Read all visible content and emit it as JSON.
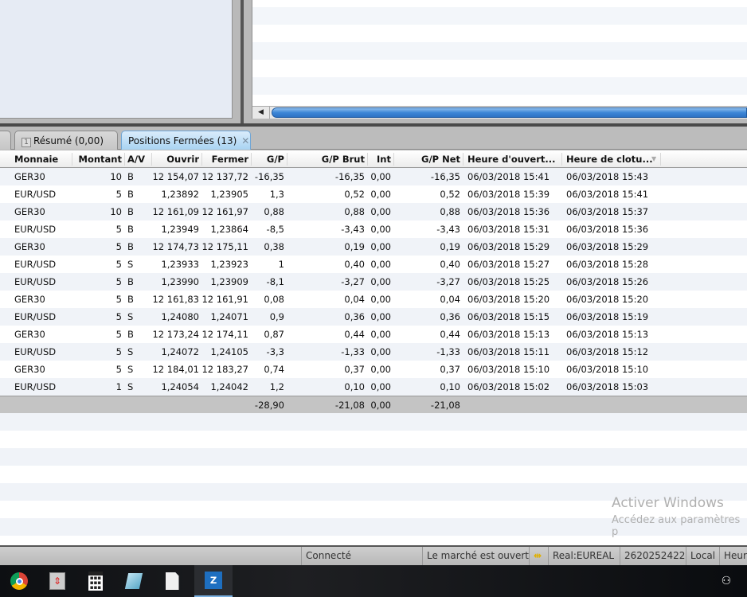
{
  "tabs": [
    {
      "num": "1",
      "label": "Résumé (0,00)"
    },
    {
      "label": "Positions Fermées (13)",
      "close": "✕"
    }
  ],
  "columns": [
    "Monnaie",
    "Montant",
    "A/V",
    "Ouvrir",
    "Fermer",
    "G/P",
    "G/P Brut",
    "Int",
    "G/P Net",
    "Heure d'ouvert...",
    "Heure de clotu..."
  ],
  "rows": [
    [
      "GER30",
      "10",
      "B",
      "12 154,07",
      "12 137,72",
      "-16,35",
      "-16,35",
      "0,00",
      "-16,35",
      "06/03/2018 15:41",
      "06/03/2018 15:43"
    ],
    [
      "EUR/USD",
      "5",
      "B",
      "1,23892",
      "1,23905",
      "1,3",
      "0,52",
      "0,00",
      "0,52",
      "06/03/2018 15:39",
      "06/03/2018 15:41"
    ],
    [
      "GER30",
      "10",
      "B",
      "12 161,09",
      "12 161,97",
      "0,88",
      "0,88",
      "0,00",
      "0,88",
      "06/03/2018 15:36",
      "06/03/2018 15:37"
    ],
    [
      "EUR/USD",
      "5",
      "B",
      "1,23949",
      "1,23864",
      "-8,5",
      "-3,43",
      "0,00",
      "-3,43",
      "06/03/2018 15:31",
      "06/03/2018 15:36"
    ],
    [
      "GER30",
      "5",
      "B",
      "12 174,73",
      "12 175,11",
      "0,38",
      "0,19",
      "0,00",
      "0,19",
      "06/03/2018 15:29",
      "06/03/2018 15:29"
    ],
    [
      "EUR/USD",
      "5",
      "S",
      "1,23933",
      "1,23923",
      "1",
      "0,40",
      "0,00",
      "0,40",
      "06/03/2018 15:27",
      "06/03/2018 15:28"
    ],
    [
      "EUR/USD",
      "5",
      "B",
      "1,23990",
      "1,23909",
      "-8,1",
      "-3,27",
      "0,00",
      "-3,27",
      "06/03/2018 15:25",
      "06/03/2018 15:26"
    ],
    [
      "GER30",
      "5",
      "B",
      "12 161,83",
      "12 161,91",
      "0,08",
      "0,04",
      "0,00",
      "0,04",
      "06/03/2018 15:20",
      "06/03/2018 15:20"
    ],
    [
      "EUR/USD",
      "5",
      "S",
      "1,24080",
      "1,24071",
      "0,9",
      "0,36",
      "0,00",
      "0,36",
      "06/03/2018 15:15",
      "06/03/2018 15:19"
    ],
    [
      "GER30",
      "5",
      "B",
      "12 173,24",
      "12 174,11",
      "0,87",
      "0,44",
      "0,00",
      "0,44",
      "06/03/2018 15:13",
      "06/03/2018 15:13"
    ],
    [
      "EUR/USD",
      "5",
      "S",
      "1,24072",
      "1,24105",
      "-3,3",
      "-1,33",
      "0,00",
      "-1,33",
      "06/03/2018 15:11",
      "06/03/2018 15:12"
    ],
    [
      "GER30",
      "5",
      "S",
      "12 184,01",
      "12 183,27",
      "0,74",
      "0,37",
      "0,00",
      "0,37",
      "06/03/2018 15:10",
      "06/03/2018 15:10"
    ],
    [
      "EUR/USD",
      "1",
      "S",
      "1,24054",
      "1,24042",
      "1,2",
      "0,10",
      "0,00",
      "0,10",
      "06/03/2018 15:02",
      "06/03/2018 15:03"
    ]
  ],
  "totals": {
    "gp": "-28,90",
    "gp_brut": "-21,08",
    "int": "0,00",
    "gp_net": "-21,08"
  },
  "watermark": {
    "title": "Activer Windows",
    "subtitle": "Accédez aux paramètres p"
  },
  "status": {
    "connection": "Connecté",
    "market": "Le marché est ouvert",
    "account": "Real:EUREAL",
    "account_id": "2620252422",
    "time_mode": "Local",
    "time_label": "Heure"
  },
  "taskbar": [
    "chrome-icon",
    "app-icon",
    "calculator-icon",
    "notepad-icon",
    "document-icon",
    "trading-app-icon"
  ]
}
